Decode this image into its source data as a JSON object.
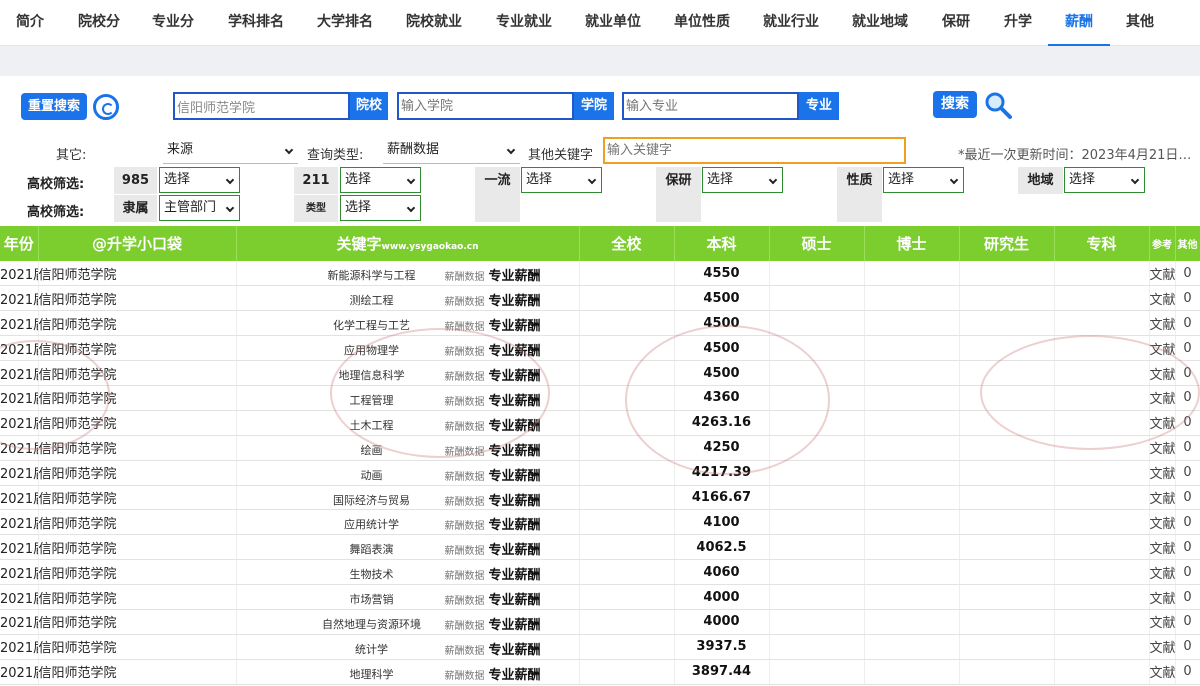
{
  "tabs": [
    {
      "label": "简介",
      "active": false
    },
    {
      "label": "院校分",
      "active": false
    },
    {
      "label": "专业分",
      "active": false
    },
    {
      "label": "学科排名",
      "active": false
    },
    {
      "label": "大学排名",
      "active": false
    },
    {
      "label": "院校就业",
      "active": false
    },
    {
      "label": "专业就业",
      "active": false
    },
    {
      "label": "就业单位",
      "active": false
    },
    {
      "label": "单位性质",
      "active": false
    },
    {
      "label": "就业行业",
      "active": false
    },
    {
      "label": "就业地域",
      "active": false
    },
    {
      "label": "保研",
      "active": false
    },
    {
      "label": "升学",
      "active": false
    },
    {
      "label": "薪酬",
      "active": true
    },
    {
      "label": "其他",
      "active": false
    }
  ],
  "search": {
    "reset_label": "重置搜索",
    "school_value": "信阳师范学院",
    "school_btn": "院校",
    "college_placeholder": "输入学院",
    "college_btn": "学院",
    "major_placeholder": "输入专业",
    "major_btn": "专业",
    "search_label": "搜索"
  },
  "filters": {
    "other_label": "其它:",
    "source_value": "来源",
    "query_type_label": "查询类型:",
    "query_type_value": "薪酬数据",
    "other_kw_label": "其他关键字",
    "kw_placeholder": "输入关键字",
    "update_text": "*最近一次更新时间：2023年4月21日…",
    "row1_label": "高校筛选:",
    "row2_label": "高校筛选:",
    "f985": "985",
    "f211": "211",
    "f_first": "一流",
    "f_baoyan": "保研",
    "f_nature": "性质",
    "f_region": "地域",
    "f_affil": "隶属",
    "f_type": "类型",
    "select_text": "选择",
    "affil_value": "主管部门"
  },
  "table": {
    "headers": {
      "year": "年份",
      "school": "@升学小口袋",
      "keyword": "关键字",
      "keyword_site": "www.ysygaokao.cn",
      "all": "全校",
      "bachelor": "本科",
      "master": "硕士",
      "doctor": "博士",
      "grad": "研究生",
      "junior": "专科",
      "ref": "参考",
      "other": "其他"
    },
    "source_tag": "薪酬数据",
    "type_tag": "专业薪酬",
    "ref_text": "文献",
    "rows": [
      {
        "year": "2021届",
        "school": "信阳师范学院",
        "major": "新能源科学与工程",
        "bachelor": "4550",
        "other": "0"
      },
      {
        "year": "2021届",
        "school": "信阳师范学院",
        "major": "测绘工程",
        "bachelor": "4500",
        "other": "0"
      },
      {
        "year": "2021届",
        "school": "信阳师范学院",
        "major": "化学工程与工艺",
        "bachelor": "4500",
        "other": "0"
      },
      {
        "year": "2021届",
        "school": "信阳师范学院",
        "major": "应用物理学",
        "bachelor": "4500",
        "other": "0"
      },
      {
        "year": "2021届",
        "school": "信阳师范学院",
        "major": "地理信息科学",
        "bachelor": "4500",
        "other": "0"
      },
      {
        "year": "2021届",
        "school": "信阳师范学院",
        "major": "工程管理",
        "bachelor": "4360",
        "other": "0"
      },
      {
        "year": "2021届",
        "school": "信阳师范学院",
        "major": "土木工程",
        "bachelor": "4263.16",
        "other": "0"
      },
      {
        "year": "2021届",
        "school": "信阳师范学院",
        "major": "绘画",
        "bachelor": "4250",
        "other": "0"
      },
      {
        "year": "2021届",
        "school": "信阳师范学院",
        "major": "动画",
        "bachelor": "4217.39",
        "other": "0"
      },
      {
        "year": "2021届",
        "school": "信阳师范学院",
        "major": "国际经济与贸易",
        "bachelor": "4166.67",
        "other": "0"
      },
      {
        "year": "2021届",
        "school": "信阳师范学院",
        "major": "应用统计学",
        "bachelor": "4100",
        "other": "0"
      },
      {
        "year": "2021届",
        "school": "信阳师范学院",
        "major": "舞蹈表演",
        "bachelor": "4062.5",
        "other": "0"
      },
      {
        "year": "2021届",
        "school": "信阳师范学院",
        "major": "生物技术",
        "bachelor": "4060",
        "other": "0"
      },
      {
        "year": "2021届",
        "school": "信阳师范学院",
        "major": "市场营销",
        "bachelor": "4000",
        "other": "0"
      },
      {
        "year": "2021届",
        "school": "信阳师范学院",
        "major": "自然地理与资源环境",
        "bachelor": "4000",
        "other": "0"
      },
      {
        "year": "2021届",
        "school": "信阳师范学院",
        "major": "统计学",
        "bachelor": "3937.5",
        "other": "0"
      },
      {
        "year": "2021届",
        "school": "信阳师范学院",
        "major": "地理科学",
        "bachelor": "3897.44",
        "other": "0"
      }
    ]
  }
}
